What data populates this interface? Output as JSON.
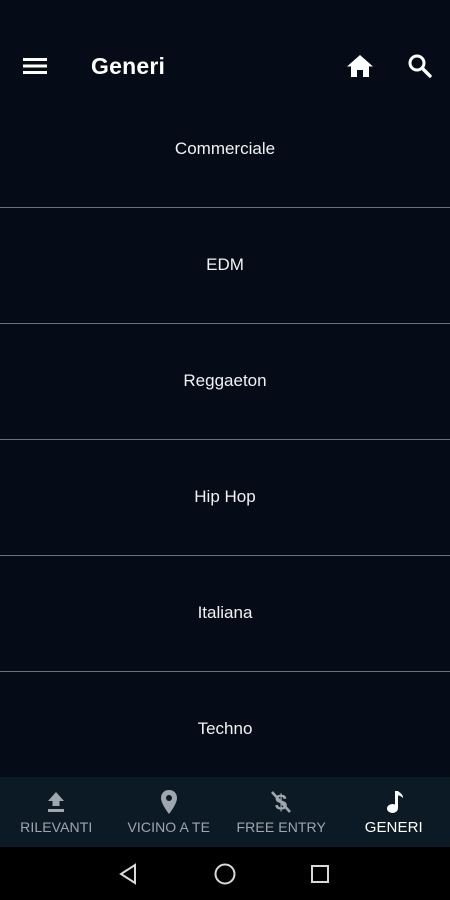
{
  "app_bar": {
    "title": "Generi",
    "icons": [
      "menu-icon",
      "home-icon",
      "search-icon"
    ]
  },
  "genres": [
    {
      "label": "Commerciale"
    },
    {
      "label": "EDM"
    },
    {
      "label": "Reggaeton"
    },
    {
      "label": "Hip Hop"
    },
    {
      "label": "Italiana"
    },
    {
      "label": "Techno"
    }
  ],
  "bottom_nav": {
    "active": "GENERI",
    "tabs": [
      {
        "label": "RILEVANTI",
        "icon": "upload-icon"
      },
      {
        "label": "VICINO A TE",
        "icon": "location-pin-icon"
      },
      {
        "label": "FREE ENTRY",
        "icon": "money-off-icon"
      },
      {
        "label": "GENERI",
        "icon": "music-note-icon"
      }
    ]
  },
  "system_nav": {
    "icons": [
      "back-icon",
      "home-circle-icon",
      "recents-icon"
    ]
  },
  "colors": {
    "background": "#050c17",
    "bottom_nav_bg": "#0c1a26",
    "divider": "#6b6f76",
    "inactive_tab": "#9fa6ad",
    "active_tab": "#ffffff"
  }
}
